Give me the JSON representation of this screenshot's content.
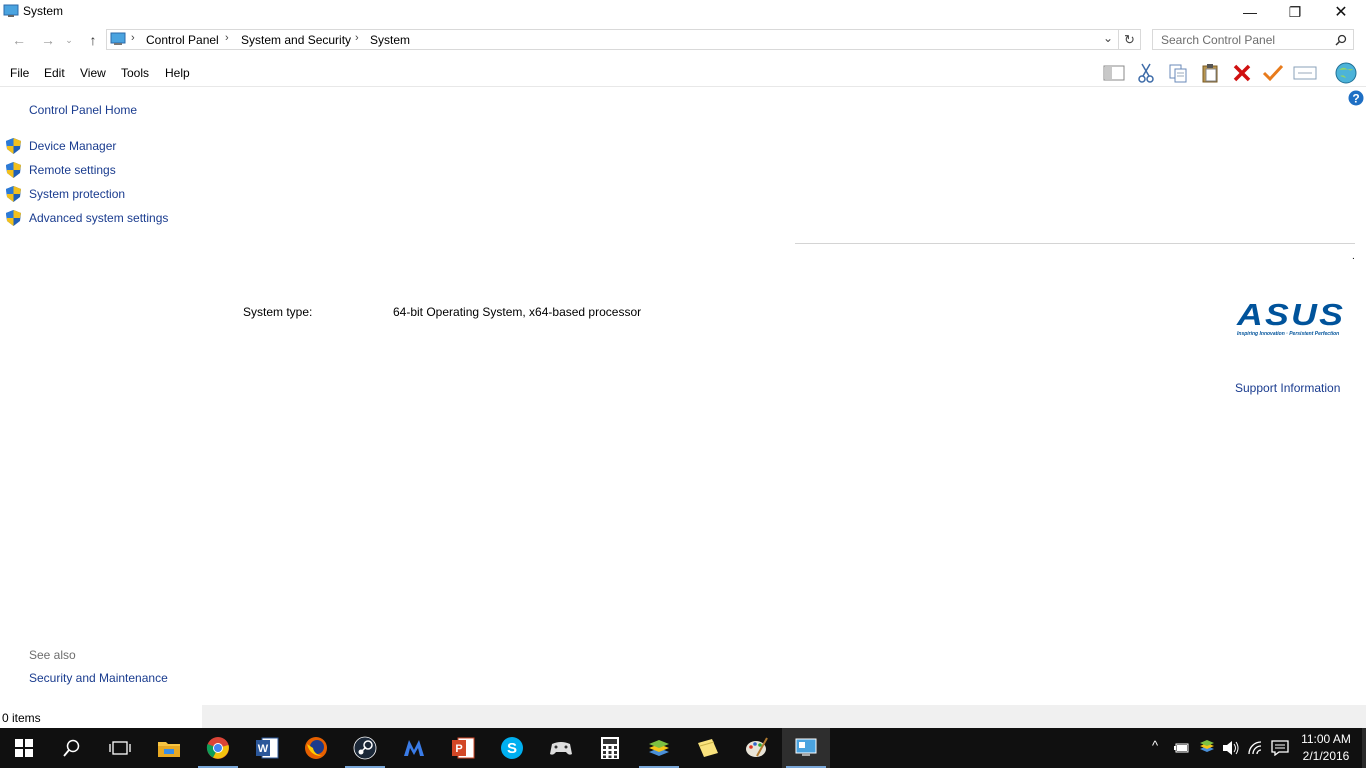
{
  "window": {
    "title": "System",
    "icon": "monitor-icon",
    "controls": {
      "minimize": "—",
      "restore": "❐",
      "close": "✕"
    }
  },
  "nav": {
    "breadcrumbs": [
      "Control Panel",
      "System and Security",
      "System"
    ],
    "search_placeholder": "Search Control Panel"
  },
  "menu": {
    "items": [
      "File",
      "Edit",
      "View",
      "Tools",
      "Help"
    ],
    "toolbar_icons": [
      "panel-toggle-icon",
      "cut-icon",
      "copy-icon",
      "paste-icon",
      "delete-icon",
      "check-icon",
      "rename-icon",
      "globe-icon"
    ]
  },
  "left_pane": {
    "home": "Control Panel Home",
    "links": [
      "Device Manager",
      "Remote settings",
      "System protection",
      "Advanced system settings"
    ],
    "see_also_heading": "See also",
    "see_also": [
      "Security and Maintenance"
    ]
  },
  "content": {
    "system_type_label": "System type:",
    "system_type_value": "64-bit Operating System, x64-based processor",
    "oem_logo_text": "ASUS",
    "oem_tagline": "Inspiring Innovation · Persistent Perfection",
    "support_link": "Support Information",
    "dot": "."
  },
  "status": {
    "items": "0 items"
  },
  "taskbar": {
    "apps": [
      "start-icon",
      "search-icon",
      "task-view-icon",
      "file-explorer-icon",
      "chrome-icon",
      "word-icon",
      "firefox-icon",
      "steam-icon",
      "malwarebytes-icon",
      "powerpoint-icon",
      "skype-icon",
      "games-icon",
      "calculator-icon",
      "bluestacks-icon",
      "sticky-notes-icon",
      "paint-icon",
      "control-panel-icon"
    ],
    "time": "11:00 AM",
    "date": "2/1/2016"
  },
  "colors": {
    "link": "#1a3c8f",
    "asus_blue": "#00539b",
    "taskbar": "#101010"
  }
}
